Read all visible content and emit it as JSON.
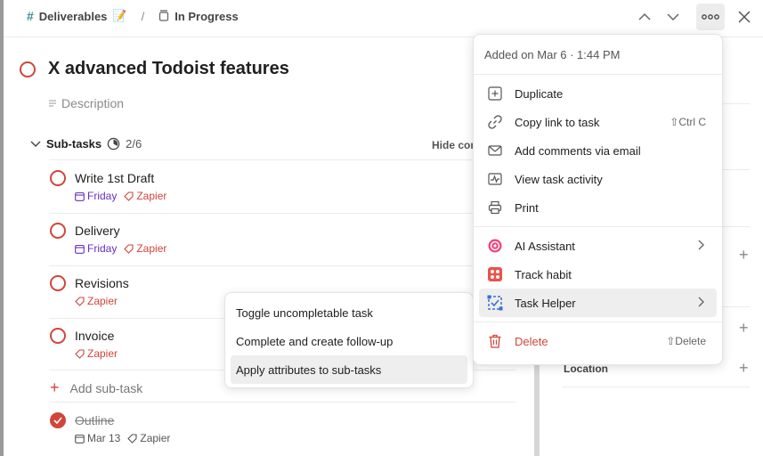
{
  "header": {
    "project": "Deliverables",
    "project_emoji": "📝",
    "section": "In Progress"
  },
  "task": {
    "title": "X advanced Todoist features",
    "description_placeholder": "Description"
  },
  "subtasks": {
    "heading": "Sub-tasks",
    "count": "2/6",
    "hide_completed": "Hide completed",
    "add_label": "Add sub-task",
    "items": [
      {
        "name": "Write 1st Draft",
        "date": "Friday",
        "label": "Zapier"
      },
      {
        "name": "Delivery",
        "date": "Friday",
        "label": "Zapier"
      },
      {
        "name": "Revisions",
        "label": "Zapier"
      },
      {
        "name": "Invoice",
        "label": "Zapier"
      },
      {
        "name": "Outline",
        "date": "Mar 13",
        "label": "Zapier"
      }
    ]
  },
  "side": {
    "location": "Location"
  },
  "menu": {
    "added": "Added on Mar 6 · 1:44 PM",
    "duplicate": "Duplicate",
    "copy_link": "Copy link to task",
    "copy_link_shortcut": "⇧Ctrl C",
    "add_comments": "Add comments via email",
    "view_activity": "View task activity",
    "print": "Print",
    "ai_assistant": "AI Assistant",
    "track_habit": "Track habit",
    "task_helper": "Task Helper",
    "delete": "Delete",
    "delete_shortcut": "⇧Delete"
  },
  "submenu": {
    "items": [
      "Toggle uncompletable task",
      "Complete and create follow-up",
      "Apply attributes to sub-tasks"
    ]
  },
  "colors": {
    "accent": "#d1453b",
    "date_purple": "#692fc2",
    "project_hash": "#3a8d8f"
  }
}
